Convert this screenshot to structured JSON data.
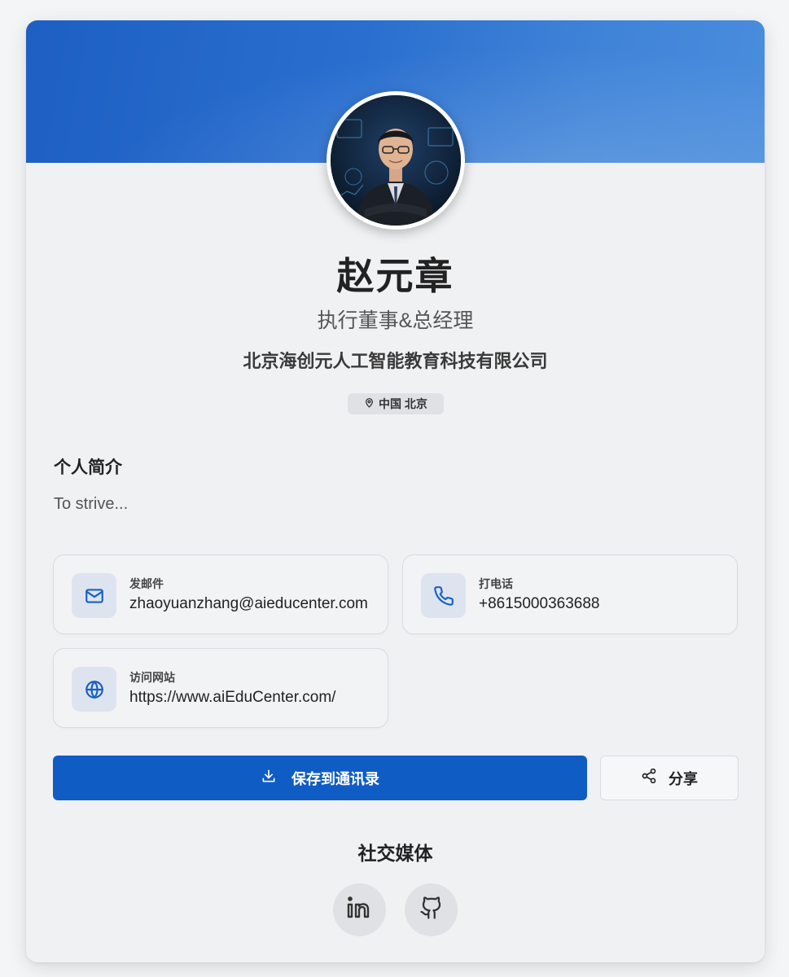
{
  "profile": {
    "name": "赵元章",
    "title": "执行董事&总经理",
    "company": "北京海创元人工智能教育科技有限公司",
    "location": "中国 北京"
  },
  "about": {
    "heading": "个人简介",
    "text": "To strive..."
  },
  "contacts": {
    "email": {
      "label": "发邮件",
      "value": "zhaoyuanzhang@aieducenter.com",
      "icon": "mail-icon"
    },
    "phone": {
      "label": "打电话",
      "value": "+8615000363688",
      "icon": "phone-icon"
    },
    "website": {
      "label": "访问网站",
      "value": "https://www.aiEduCenter.com/",
      "icon": "globe-icon"
    }
  },
  "actions": {
    "save_label": "保存到通讯录",
    "share_label": "分享"
  },
  "social": {
    "heading": "社交媒体",
    "items": [
      "linkedin-icon",
      "github-icon"
    ]
  },
  "colors": {
    "primary": "#0f5cc5",
    "banner": "#2a6fcf",
    "icon_bg": "#dde4ef"
  }
}
